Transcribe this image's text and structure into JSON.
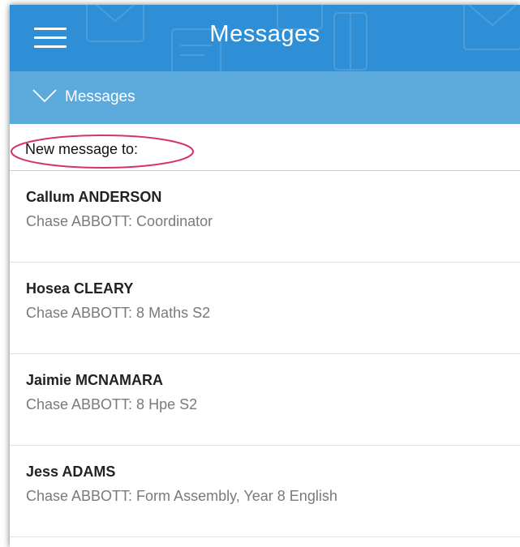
{
  "header": {
    "title": "Messages",
    "menu_icon": "hamburger-menu-icon",
    "background_color": "#2f8fd6"
  },
  "subheader": {
    "label": "Messages",
    "icon": "chevron-down-icon",
    "background_color": "#5ca9dc"
  },
  "compose": {
    "label": "New message to:",
    "highlight_color": "#d6336c"
  },
  "recipients": [
    {
      "name": "Callum ANDERSON",
      "role": "Chase ABBOTT: Coordinator"
    },
    {
      "name": "Hosea CLEARY",
      "role": "Chase ABBOTT: 8 Maths S2"
    },
    {
      "name": "Jaimie MCNAMARA",
      "role": "Chase ABBOTT: 8 Hpe S2"
    },
    {
      "name": "Jess ADAMS",
      "role": "Chase ABBOTT: Form Assembly, Year 8 English"
    }
  ]
}
